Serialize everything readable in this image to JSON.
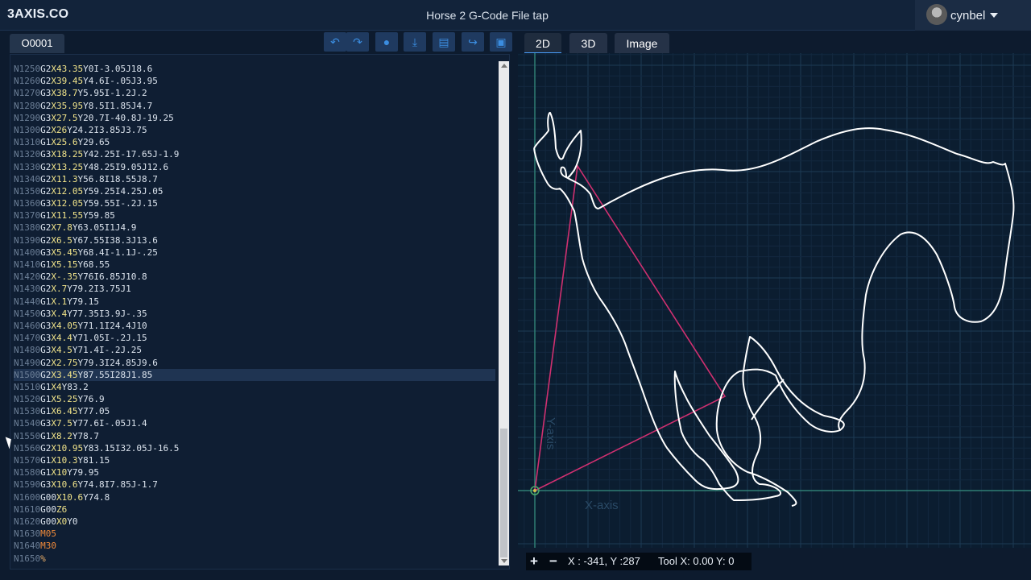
{
  "app": {
    "logo": "3AXIS.CO",
    "title": "Horse 2 G-Code File tap",
    "user": "cynbel"
  },
  "editor": {
    "tab_label": "O0001",
    "toolbar_icons": [
      "undo-icon",
      "redo-icon",
      "comment-icon",
      "download-icon",
      "document-icon",
      "share-icon",
      "save-icon"
    ],
    "highlighted_index": 25,
    "lines": [
      [
        "N1250",
        "G2",
        "X43.35",
        "Y0",
        "I-3.05J18.6"
      ],
      [
        "N1260",
        "G2",
        "X39.45",
        "Y4.6",
        "I-.05J3.95"
      ],
      [
        "N1270",
        "G3",
        "X38.7",
        "Y5.95",
        "I-1.2J.2"
      ],
      [
        "N1280",
        "G2",
        "X35.95",
        "Y8.5",
        "I1.85J4.7"
      ],
      [
        "N1290",
        "G3",
        "X27.5",
        "Y20.7",
        "I-40.8J-19.25"
      ],
      [
        "N1300",
        "G2",
        "X26",
        "Y24.2",
        "I3.85J3.75"
      ],
      [
        "N1310",
        "G1",
        "X25.6",
        "Y29.65",
        ""
      ],
      [
        "N1320",
        "G3",
        "X18.25",
        "Y42.25",
        "I-17.65J-1.9"
      ],
      [
        "N1330",
        "G2",
        "X13.25",
        "Y48.25",
        "I9.05J12.6"
      ],
      [
        "N1340",
        "G2",
        "X11.3",
        "Y56.8",
        "I18.55J8.7"
      ],
      [
        "N1350",
        "G2",
        "X12.05",
        "Y59.25",
        "I4.25J.05"
      ],
      [
        "N1360",
        "G3",
        "X12.05",
        "Y59.55",
        "I-.2J.15"
      ],
      [
        "N1370",
        "G1",
        "X11.55",
        "Y59.85",
        ""
      ],
      [
        "N1380",
        "G2",
        "X7.8",
        "Y63.05",
        "I1J4.9"
      ],
      [
        "N1390",
        "G2",
        "X6.5",
        "Y67.55",
        "I38.3J13.6"
      ],
      [
        "N1400",
        "G3",
        "X5.45",
        "Y68.4",
        "I-1.1J-.25"
      ],
      [
        "N1410",
        "G1",
        "X5.15",
        "Y68.55",
        ""
      ],
      [
        "N1420",
        "G2",
        "X-.35",
        "Y76",
        "I6.85J10.8"
      ],
      [
        "N1430",
        "G2",
        "X.7",
        "Y79.2",
        "I3.75J1"
      ],
      [
        "N1440",
        "G1",
        "X.1",
        "Y79.15",
        ""
      ],
      [
        "N1450",
        "G3",
        "X.4",
        "Y77.35",
        "I3.9J-.35"
      ],
      [
        "N1460",
        "G3",
        "X4.05",
        "Y71.1",
        "I24.4J10"
      ],
      [
        "N1470",
        "G3",
        "X4.4",
        "Y71.05",
        "I-.2J.15"
      ],
      [
        "N1480",
        "G3",
        "X4.5",
        "Y71.4",
        "I-.2J.25"
      ],
      [
        "N1490",
        "G2",
        "X2.75",
        "Y79.3",
        "I24.85J9.6"
      ],
      [
        "N1500",
        "G2",
        "X3.45",
        "Y87.55",
        "I28J1.85"
      ],
      [
        "N1510",
        "G1",
        "X4",
        "Y83.2",
        ""
      ],
      [
        "N1520",
        "G1",
        "X5.25",
        "Y76.9",
        ""
      ],
      [
        "N1530",
        "G1",
        "X6.45",
        "Y77.05",
        ""
      ],
      [
        "N1540",
        "G3",
        "X7.5",
        "Y77.6",
        "I-.05J1.4"
      ],
      [
        "N1550",
        "G1",
        "X8.2",
        "Y78.7",
        ""
      ],
      [
        "N1560",
        "G2",
        "X10.95",
        "Y83.15",
        "I32.05J-16.5"
      ],
      [
        "N1570",
        "G1",
        "X10.3",
        "Y81.15",
        ""
      ],
      [
        "N1580",
        "G1",
        "X10",
        "Y79.95",
        ""
      ],
      [
        "N1590",
        "G3",
        "X10.6",
        "Y74.8",
        "I7.85J-1.7"
      ],
      [
        "N1600",
        "G00",
        "X10.6",
        "Y74.8",
        ""
      ],
      [
        "N1610",
        "G00",
        "Z6",
        "",
        ""
      ],
      [
        "N1620",
        "G00",
        "X0",
        "Y0",
        ""
      ],
      [
        "N1630",
        "M05",
        "",
        "",
        ""
      ],
      [
        "N1640",
        "M30",
        "",
        "",
        ""
      ],
      [
        "N1650",
        "%",
        "",
        "",
        ""
      ]
    ]
  },
  "viewer": {
    "tabs": [
      "2D",
      "3D",
      "Image"
    ],
    "active_tab": "2D",
    "y_axis_label": "Y-axis",
    "x_axis_label": "X-axis",
    "grid_color": "#1c3a55",
    "axis_color": "#2f7f74",
    "toolpath_color": "#ffffff",
    "rapid_color": "#d03070"
  },
  "status": {
    "zoom_in": "+",
    "zoom_out": "−",
    "coords": "X : -341, Y :287",
    "tool": "Tool X: 0.00 Y: 0"
  }
}
